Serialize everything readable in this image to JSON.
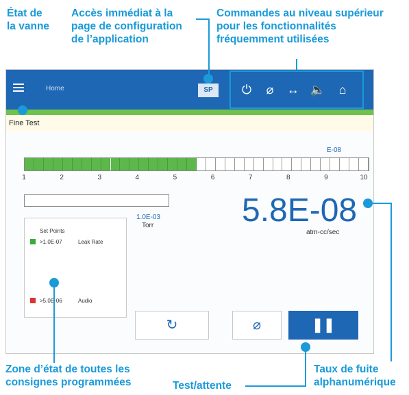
{
  "callouts": {
    "valve_state": "État de\nla vanne",
    "config_access": "Accès immédiat à la\npage de configuration\nde l’application",
    "top_commands": "Commandes au niveau supérieur\npour les fonctionnalités\nfréquemment utilisées",
    "setpoints_zone": "Zone d’état de toutes les\nconsignes programmées",
    "test_hold": "Test/attente",
    "leak_rate": "Taux de fuite\nalphanumérique"
  },
  "topbar": {
    "home_label": "Home",
    "sp_label": "SP",
    "icons": [
      "power-icon",
      "zero-icon",
      "sniff-icon",
      "volume-icon",
      "home-icon"
    ]
  },
  "status": {
    "text": "Fine Test"
  },
  "bar": {
    "unit": "E-08",
    "ticks": [
      "1",
      "2",
      "3",
      "4",
      "5",
      "6",
      "7",
      "8",
      "9",
      "10"
    ],
    "level_fraction": 0.5
  },
  "pressure": {
    "value": "1.0E-03",
    "unit": "Torr"
  },
  "leak": {
    "value": "5.8E-08",
    "unit": "atm-cc/sec"
  },
  "setpoints": {
    "title": "Set Points",
    "items": [
      {
        "value": ">1.0E-07",
        "label": "Leak Rate",
        "color": "#3daa3d"
      },
      {
        "value": ">5.0E-06",
        "label": "Audio",
        "color": "#dd3333"
      }
    ]
  },
  "buttons": {
    "cycle_icon": "↻",
    "zero_icon": "⌀",
    "pause_icon": "❚❚"
  },
  "colors": {
    "accent": "#1a9ad9",
    "brand": "#1e67b5",
    "green": "#6fc24b"
  }
}
